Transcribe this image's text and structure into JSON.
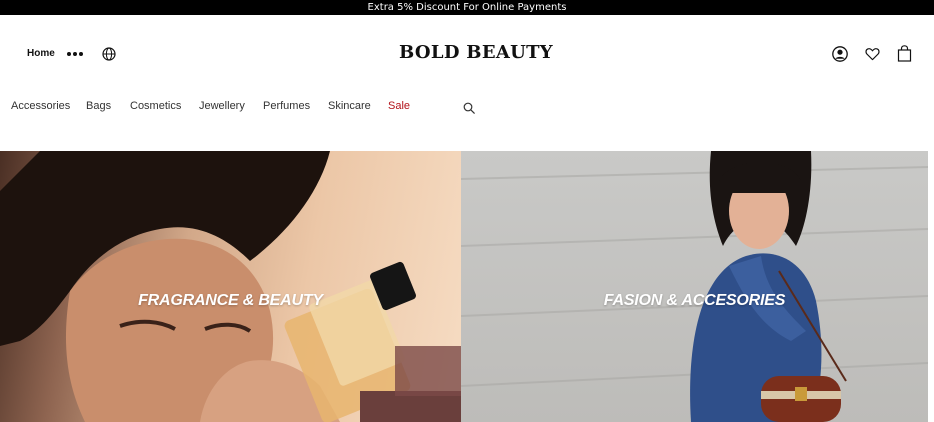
{
  "promo": {
    "text": "Extra 5% Discount For Online Payments"
  },
  "header": {
    "home_label": "Home",
    "brand": "BOLD BEAUTY",
    "icons": [
      "more-icon",
      "globe-icon",
      "account-icon",
      "wishlist-icon",
      "bag-icon"
    ]
  },
  "nav": {
    "items": [
      {
        "label": "Accessories"
      },
      {
        "label": "Bags"
      },
      {
        "label": "Cosmetics"
      },
      {
        "label": "Jewellery"
      },
      {
        "label": "Perfumes"
      },
      {
        "label": "Skincare"
      },
      {
        "label": "Sale"
      }
    ],
    "search_icon": "search-icon"
  },
  "hero": {
    "tiles": [
      {
        "title": "FRAGRANCE & BEAUTY"
      },
      {
        "title": "FASION & ACCESORIES"
      }
    ]
  },
  "colors": {
    "promo_bg": "#000000",
    "sale": "#b3121a",
    "text": "#111111"
  }
}
